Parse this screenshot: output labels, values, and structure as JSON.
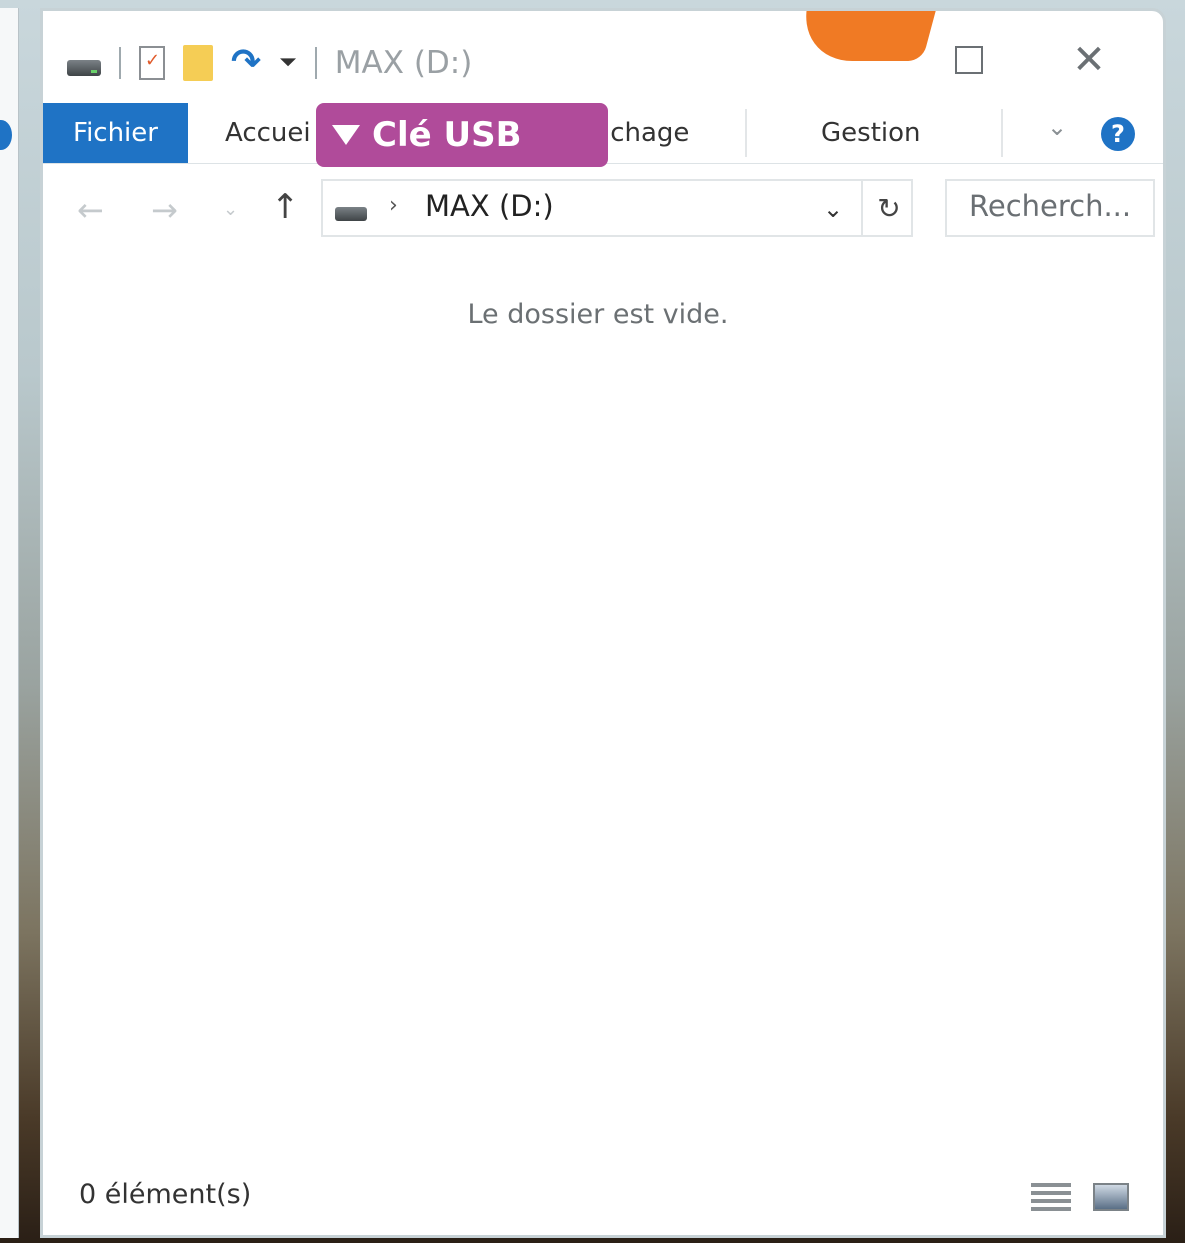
{
  "window": {
    "title": "MAX (D:)",
    "maximize_icon": "maximize-icon",
    "close_icon": "close-icon"
  },
  "ribbon": {
    "tabs": [
      {
        "label": "Fichier",
        "active": true
      },
      {
        "label": "Accueil"
      },
      {
        "label": "Affichage"
      },
      {
        "label": "Gestion"
      }
    ],
    "visible_labels": {
      "file": "Fichier",
      "home": "Accuei",
      "view": "ichage",
      "manage": "Gestion"
    },
    "help_label": "?"
  },
  "badge": {
    "label": "Clé USB",
    "color": "#b04b9a"
  },
  "accent": "#1f73c5",
  "orange_accent": "#f07a24",
  "address": {
    "separator": "›",
    "path": "MAX (D:)"
  },
  "search": {
    "placeholder": "Recherch..."
  },
  "content": {
    "empty_message": "Le dossier est vide."
  },
  "status": {
    "items": "0 élément(s)"
  }
}
